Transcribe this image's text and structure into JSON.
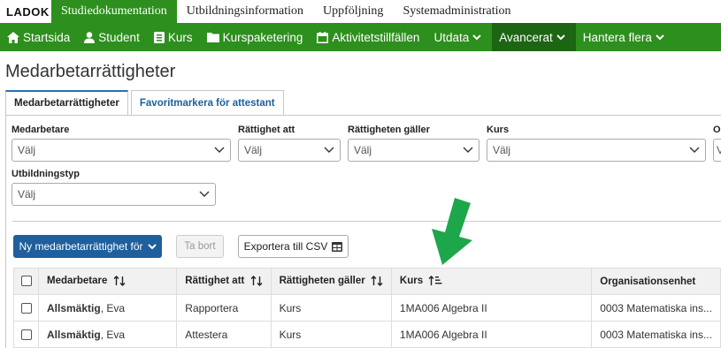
{
  "top": {
    "logo": "LADOK",
    "nav": [
      "Studiedokumentation",
      "Utbildningsinformation",
      "Uppföljning",
      "Systemadministration"
    ]
  },
  "menu": {
    "items": [
      {
        "label": "Startsida",
        "icon": "home-icon"
      },
      {
        "label": "Student",
        "icon": "user-icon"
      },
      {
        "label": "Kurs",
        "icon": "book-icon"
      },
      {
        "label": "Kurspaketering",
        "icon": "folder-icon"
      },
      {
        "label": "Aktivitetstillfällen",
        "icon": "calendar-icon"
      },
      {
        "label": "Utdata",
        "icon": "chevron-down-icon"
      },
      {
        "label": "Avancerat",
        "icon": "chevron-down-icon"
      },
      {
        "label": "Hantera flera",
        "icon": "chevron-down-icon"
      }
    ]
  },
  "page": {
    "title": "Medarbetarrättigheter",
    "tabs": [
      "Medarbetarrättigheter",
      "Favoritmarkera för attestant"
    ]
  },
  "filters": {
    "medarbetare": {
      "label": "Medarbetare",
      "value": "Välj"
    },
    "rattighet_att": {
      "label": "Rättighet att",
      "value": "Välj"
    },
    "rattigheten_galler": {
      "label": "Rättigheten gäller",
      "value": "Välj"
    },
    "kurs": {
      "label": "Kurs",
      "value": "Välj"
    },
    "org": {
      "label": "O",
      "value": "V"
    },
    "utbildningstyp": {
      "label": "Utbildningstyp",
      "value": "Välj"
    }
  },
  "actions": {
    "new": "Ny medarbetarrättighet för",
    "remove": "Ta bort",
    "export": "Exportera till CSV"
  },
  "table": {
    "headers": [
      "Medarbetare",
      "Rättighet att",
      "Rättigheten gäller",
      "Kurs",
      "Organisationsenhet"
    ],
    "rows": [
      {
        "last": "Allsmäktig",
        "first": ", Eva",
        "rattighet": "Rapportera",
        "galler": "Kurs",
        "kurs": "1MA006 Algebra II",
        "org": "0003 Matematiska ins..."
      },
      {
        "last": "Allsmäktig",
        "first": ", Eva",
        "rattighet": "Attestera",
        "galler": "Kurs",
        "kurs": "1MA006 Algebra II",
        "org": "0003 Matematiska ins..."
      }
    ]
  },
  "colors": {
    "brand_green": "#2d8f1d",
    "active_menu": "#1c6512",
    "primary_blue": "#1f5f9c",
    "annotation_arrow": "#1ea64b"
  }
}
